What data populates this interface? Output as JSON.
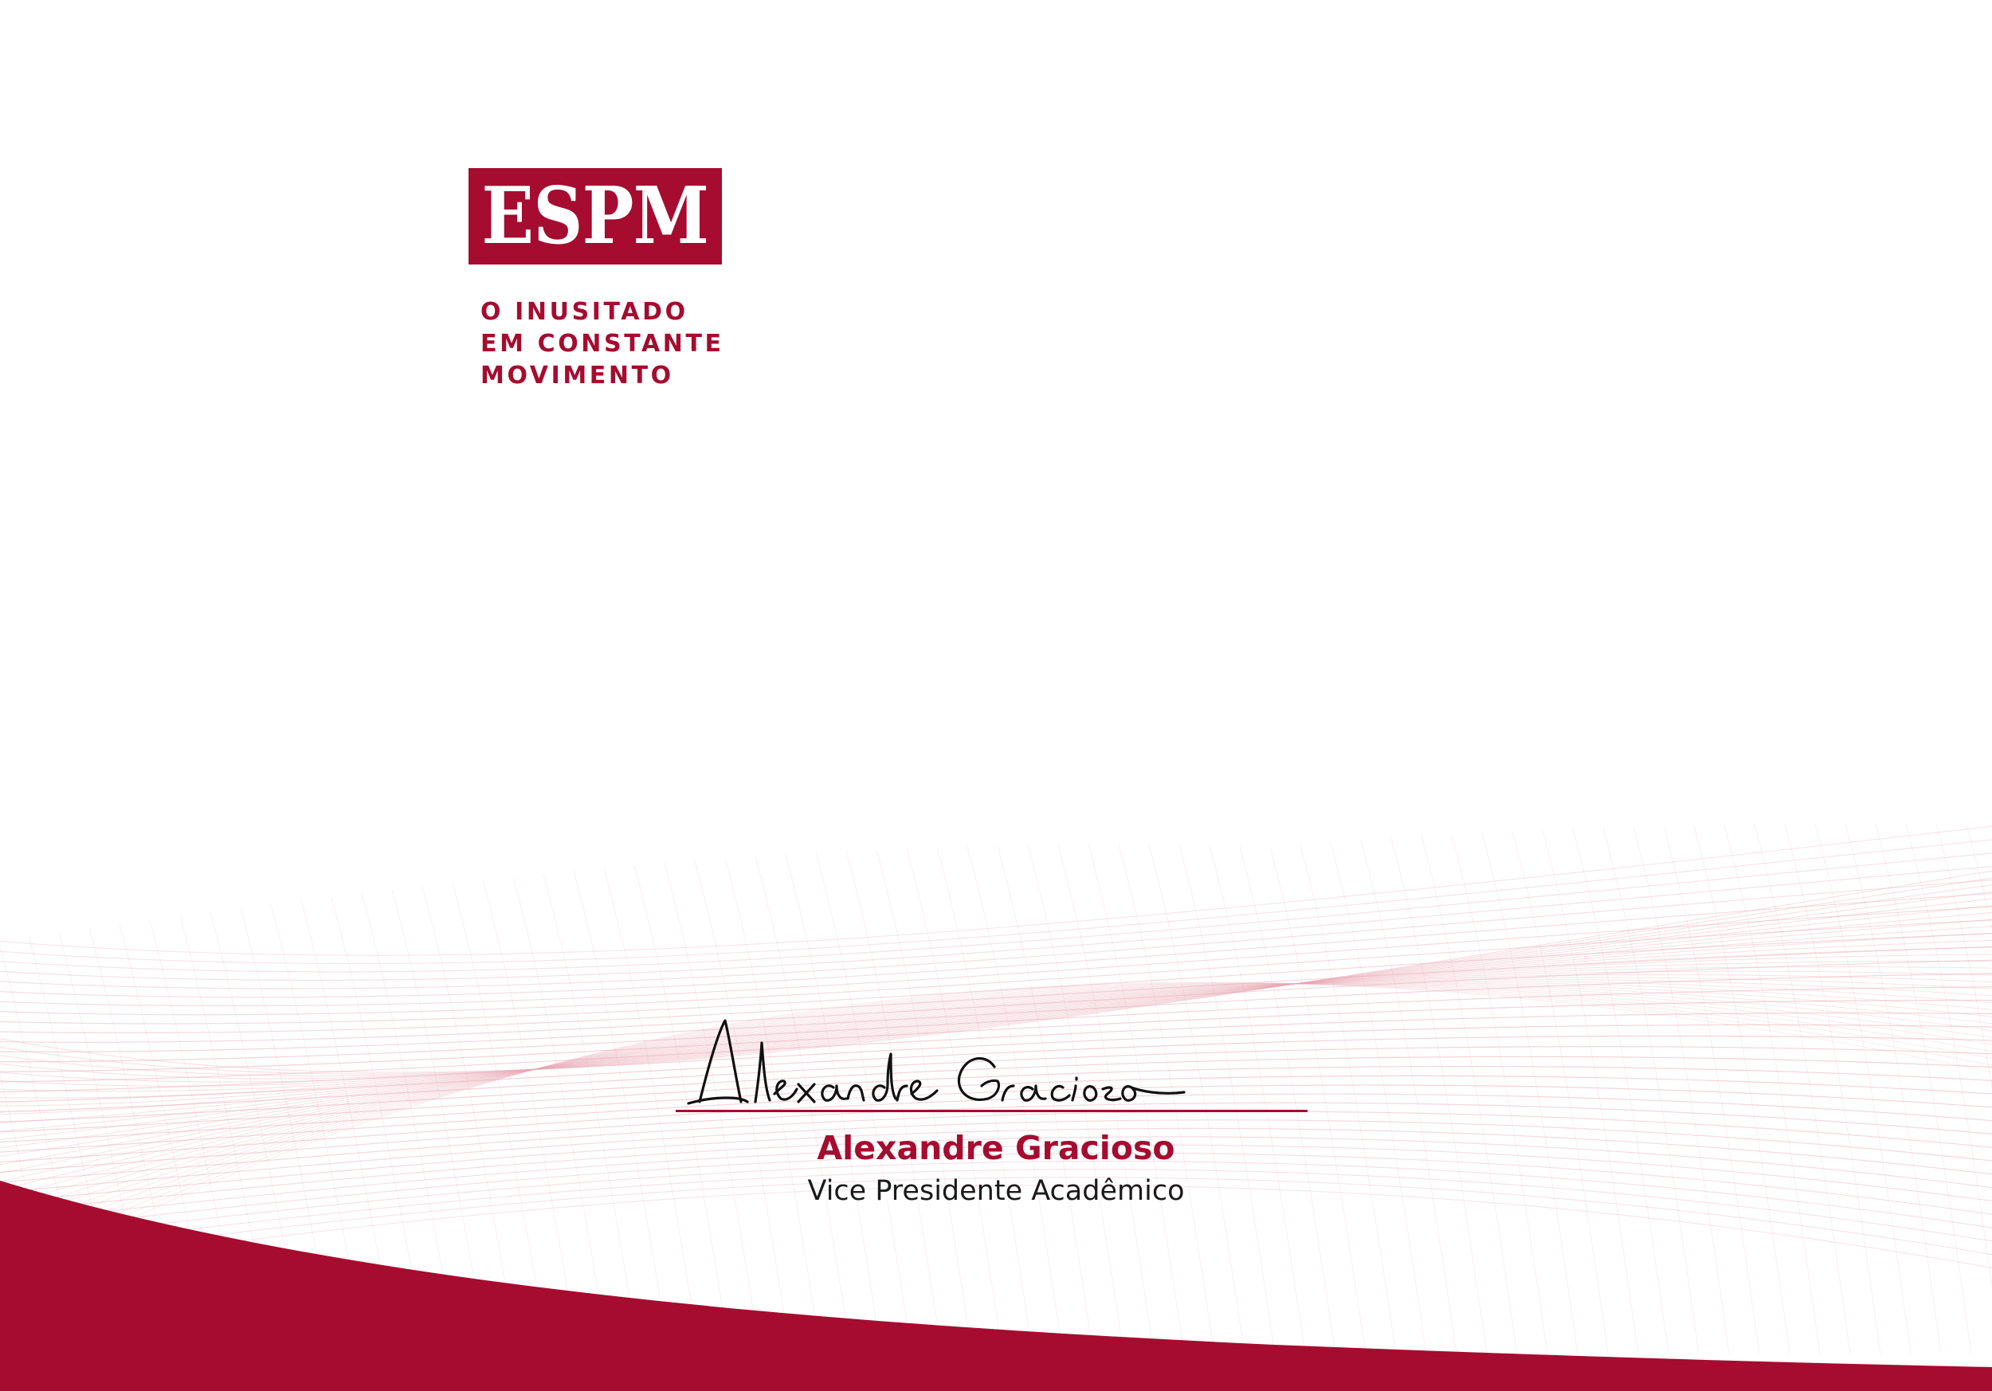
{
  "brand": {
    "logo_text": "ESPM",
    "tagline_lines": [
      "O INUSITADO",
      "EM CONSTANTE",
      "MOVIMENTO"
    ]
  },
  "signer": {
    "name": "Alexandre Gracioso",
    "title": "Vice Presidente Acadêmico",
    "signature_text": "Alexandre Gracioso"
  },
  "colors": {
    "brand_red": "#a50c2f",
    "mesh_line": "#e8a6b2",
    "text_dark": "#1a1a1a"
  }
}
